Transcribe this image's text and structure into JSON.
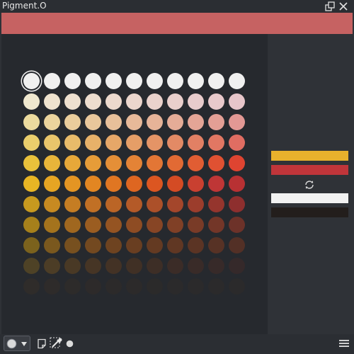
{
  "window": {
    "title": "Pigment.O"
  },
  "strip_color": "#c66262",
  "palette": {
    "rows": [
      [
        "#f0f0f0",
        "#f0f0f0",
        "#f0f0f0",
        "#f0f0f0",
        "#f0f0f0",
        "#f0f0f0",
        "#f0f0f0",
        "#f0f0f0",
        "#f0f0f0",
        "#f0f0f0",
        "#f0f0f0"
      ],
      [
        "#f0e8cf",
        "#efe3cf",
        "#eee0cf",
        "#edddce",
        "#ecd9cd",
        "#ebd6cd",
        "#ead2cc",
        "#e9cfcc",
        "#e8cccc",
        "#e8c9cb",
        "#e7c6ca"
      ],
      [
        "#ecdb9e",
        "#ebd49d",
        "#eacd9c",
        "#e9c79b",
        "#e8c09a",
        "#e7b999",
        "#e6b398",
        "#e5ac97",
        "#e4a596",
        "#e39f95",
        "#e29894"
      ],
      [
        "#eace6c",
        "#e9c56b",
        "#e8bb6a",
        "#e7b169",
        "#e6a768",
        "#e59e67",
        "#e49466",
        "#e38a65",
        "#e28064",
        "#e17763",
        "#e06d62"
      ],
      [
        "#e9c13b",
        "#e8b53a",
        "#e7a839",
        "#e69c38",
        "#e58f37",
        "#e48336",
        "#e37635",
        "#e26a34",
        "#e15d33",
        "#e05132",
        "#df4431"
      ],
      [
        "#e8b524",
        "#e6a523",
        "#e49523",
        "#e28622",
        "#e07622",
        "#de6621",
        "#dc5621",
        "#d44b24",
        "#c94030",
        "#bf3636",
        "#b83133"
      ],
      [
        "#c7991f",
        "#c78a21",
        "#c57d23",
        "#c17025",
        "#bb6526",
        "#b45a28",
        "#ac5029",
        "#a4462b",
        "#9c3d2c",
        "#95352d",
        "#8e2f2e"
      ],
      [
        "#a6801b",
        "#a4731d",
        "#a0671f",
        "#9b5d21",
        "#955422",
        "#8e4c23",
        "#874525",
        "#804026",
        "#793b27",
        "#733628",
        "#6d3229"
      ],
      [
        "#7b621d",
        "#7a581e",
        "#77501f",
        "#734920",
        "#6e4320",
        "#693e21",
        "#643a22",
        "#603723",
        "#5b3424",
        "#573225",
        "#533026"
      ],
      [
        "#4e4226",
        "#4c3d26",
        "#493925",
        "#463525",
        "#433225",
        "#403025",
        "#3d2e26",
        "#3b2c27",
        "#392b28",
        "#372a29",
        "#35292a"
      ],
      [
        "#2f2c2a",
        "#2e2b2a",
        "#2d2b2a",
        "#2d2a2a",
        "#2c2a2a",
        "#2c2a2a",
        "#2b2a2a",
        "#2b2a2b",
        "#2b2a2b",
        "#2b2a2b",
        "#2b2a2b"
      ]
    ],
    "selected": [
      0,
      0
    ]
  },
  "side": {
    "foreground_color": "#e8b12c",
    "background_color": "#c0353a",
    "white_color": "#f2f2f2",
    "black_color": "#231e1c"
  },
  "icons": {
    "undock": "undock-icon",
    "close": "close-icon",
    "swap": "swap-colors-icon",
    "mode": "color-circle-icon",
    "dropdown": "chevron-down-icon",
    "note": "note-icon",
    "picker": "eyedropper-icon",
    "dot": "dot-icon",
    "menu": "hamburger-menu-icon"
  }
}
